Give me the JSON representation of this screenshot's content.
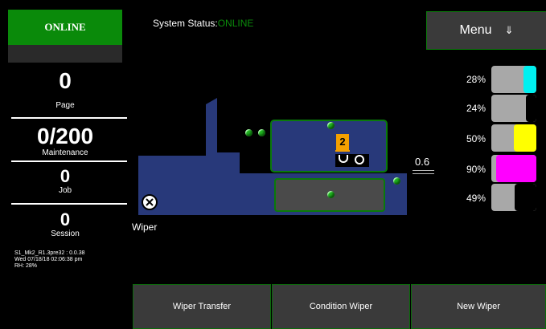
{
  "left_panel": {
    "online_badge": "ONLINE",
    "page_count": "0",
    "page_label": "Page",
    "maintenance_count": "0/200",
    "maintenance_label": "Maintenance",
    "job_count": "0",
    "job_label": "Job",
    "session_count": "0",
    "session_label": "Session",
    "info_version": "S1_Mk2_R1.3pre32 : 0.0.38",
    "info_datetime": "Wed 07/18/18 02:06:38 pm",
    "info_rh": "RH: 28%"
  },
  "header": {
    "status_label": "System Status:",
    "status_value": "ONLINE",
    "menu_label": "Menu",
    "menu_icon": "double-arrow-down-icon"
  },
  "diagram": {
    "carriage_badge": "2",
    "wiper_label": "Wiper",
    "gap_value": "0.6",
    "colors": {
      "body": "#28397a",
      "border": "#0a7a0a",
      "dot": "#1fb21f",
      "badge": "#f5a000"
    }
  },
  "ink_levels": [
    {
      "percent": "28%",
      "level": 0.28,
      "color": "#00f0f0"
    },
    {
      "percent": "24%",
      "level": 0.24,
      "color": "#000000"
    },
    {
      "percent": "50%",
      "level": 0.5,
      "color": "#ffff00"
    },
    {
      "percent": "90%",
      "level": 0.9,
      "color": "#ff00ff"
    },
    {
      "percent": "49%",
      "level": 0.49,
      "color": "#000000"
    }
  ],
  "buttons": {
    "wiper_transfer": "Wiper Transfer",
    "condition_wiper": "Condition Wiper",
    "new_wiper": "New Wiper"
  }
}
